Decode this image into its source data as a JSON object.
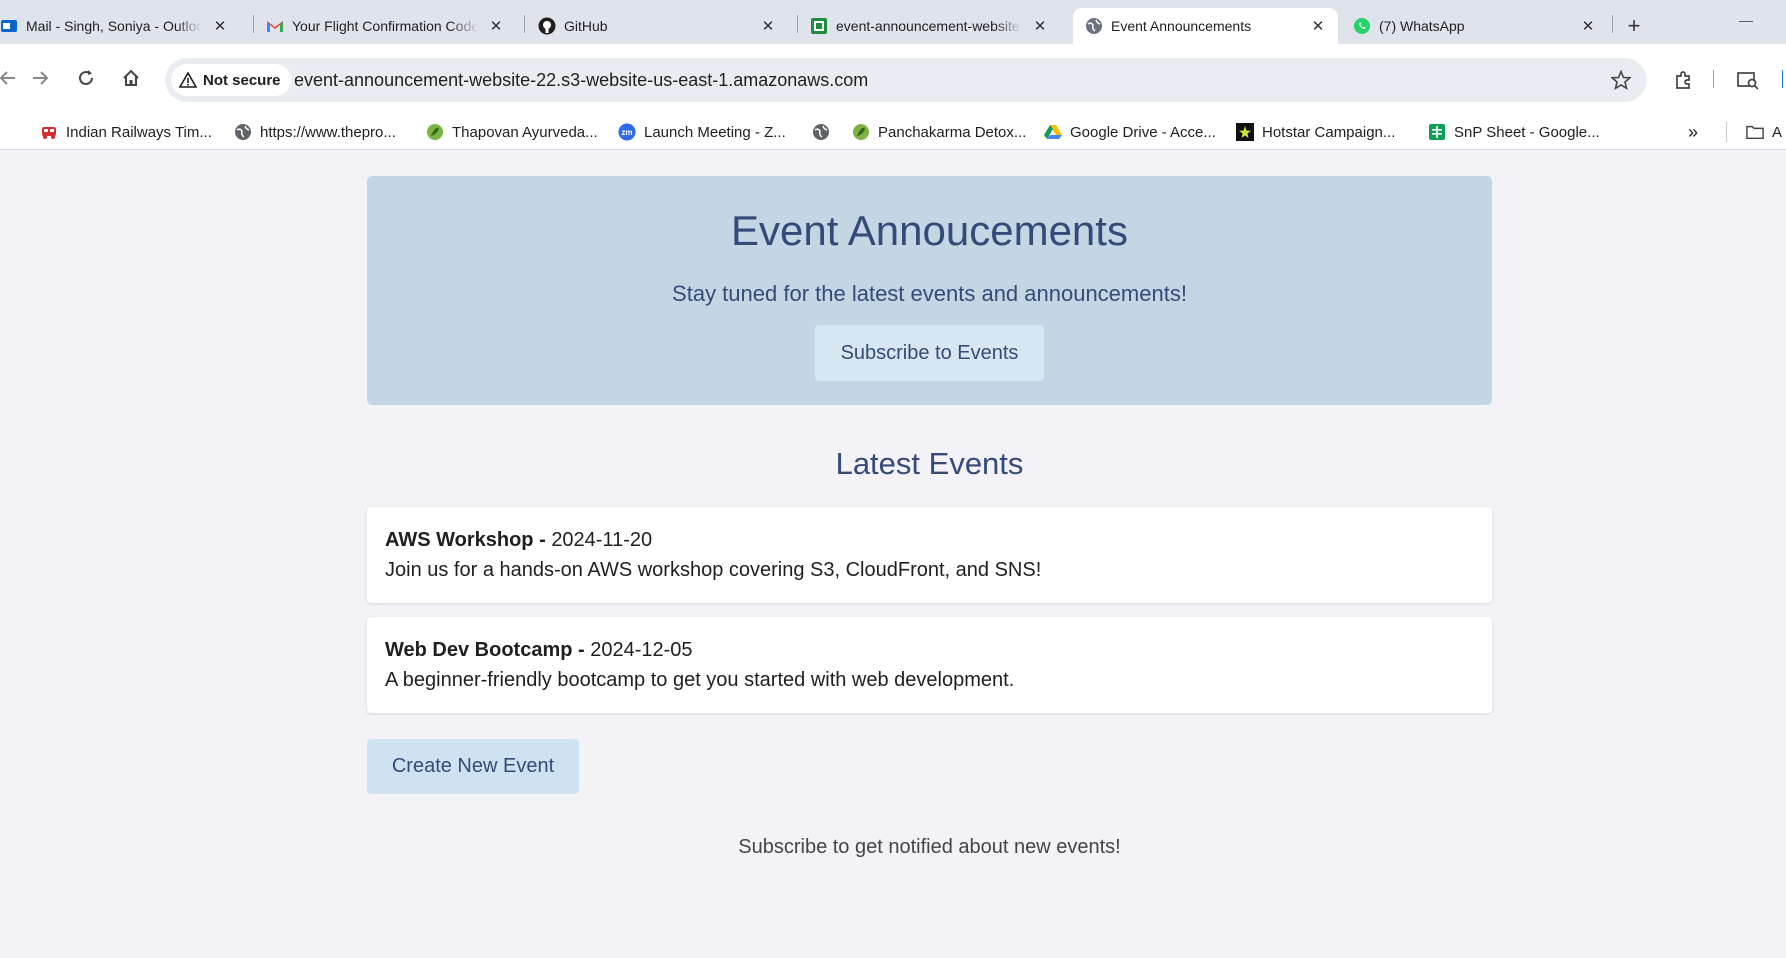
{
  "tabs": [
    {
      "title": "Mail - Singh, Soniya - Outlook",
      "icon": "outlook-icon"
    },
    {
      "title": "Your Flight Confirmation Code",
      "icon": "gmail-icon"
    },
    {
      "title": "GitHub",
      "icon": "github-icon"
    },
    {
      "title": "event-announcement-website",
      "icon": "sheet-icon"
    },
    {
      "title": "Event Announcements",
      "icon": "globe-icon",
      "active": true
    },
    {
      "title": "(7) WhatsApp",
      "icon": "whatsapp-icon"
    }
  ],
  "toolbar": {
    "security_label": "Not secure",
    "url": "event-announcement-website-22.s3-website-us-east-1.amazonaws.com"
  },
  "bookmarks": [
    {
      "label": "Indian Railways Tim...",
      "icon": "train-icon"
    },
    {
      "label": "https://www.thepro...",
      "icon": "globe-icon"
    },
    {
      "label": "Thapovan Ayurveda...",
      "icon": "leaf-icon"
    },
    {
      "label": "Launch Meeting - Z...",
      "icon": "zoom-icon"
    },
    {
      "label": "",
      "icon": "globe-icon"
    },
    {
      "label": "Panchakarma Detox...",
      "icon": "leaf-icon"
    },
    {
      "label": "Google Drive - Acce...",
      "icon": "drive-icon"
    },
    {
      "label": "Hotstar Campaign...",
      "icon": "hotstar-icon"
    },
    {
      "label": "SnP Sheet - Google...",
      "icon": "sheets-icon"
    }
  ],
  "bookmarks_overflow": "»",
  "bookmarks_folder_label": "A",
  "hero": {
    "title": "Event Annoucements",
    "subtitle": "Stay tuned for the latest events and announcements!",
    "subscribe_label": "Subscribe to Events"
  },
  "latest_heading": "Latest Events",
  "events": [
    {
      "name": "AWS Workshop",
      "separator": " - ",
      "date": "2024-11-20",
      "description": "Join us for a hands-on AWS workshop covering S3, CloudFront, and SNS!"
    },
    {
      "name": "Web Dev Bootcamp",
      "separator": " - ",
      "date": "2024-12-05",
      "description": "A beginner-friendly bootcamp to get you started with web development."
    }
  ],
  "create_label": "Create New Event",
  "footer_text": "Subscribe to get notified about new events!",
  "colors": {
    "hero_bg": "#c4d6e3",
    "heading_text": "#344a78",
    "page_bg": "#f3f3f7"
  }
}
